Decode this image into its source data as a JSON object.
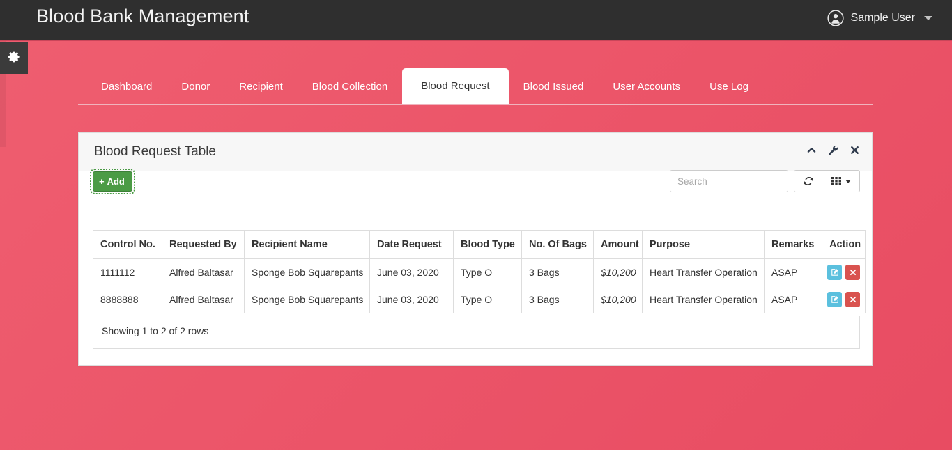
{
  "header": {
    "brand": "Blood Bank Management",
    "user_name": "Sample User",
    "user_icon": "user-circle-icon",
    "caret_icon": "chevron-down-icon",
    "gear_icon": "gear-icon"
  },
  "tabs": [
    {
      "label": "Dashboard",
      "active": false
    },
    {
      "label": "Donor",
      "active": false
    },
    {
      "label": "Recipient",
      "active": false
    },
    {
      "label": "Blood Collection",
      "active": false
    },
    {
      "label": "Blood Request",
      "active": true
    },
    {
      "label": "Blood Issued",
      "active": false
    },
    {
      "label": "User Accounts",
      "active": false
    },
    {
      "label": "Use Log",
      "active": false
    }
  ],
  "panel": {
    "title": "Blood Request Table",
    "tools": [
      {
        "name": "collapse-icon",
        "glyph": "chevron-up"
      },
      {
        "name": "wrench-icon",
        "glyph": "wrench"
      },
      {
        "name": "close-icon",
        "glyph": "times"
      }
    ]
  },
  "toolbar": {
    "add_label": "Add",
    "add_plus": "+",
    "search_placeholder": "Search",
    "search_value": "",
    "refresh_icon": "refresh-icon",
    "columns_icon": "columns-grid-icon"
  },
  "table": {
    "columns": [
      "Control No.",
      "Requested By",
      "Recipient Name",
      "Date Request",
      "Blood Type",
      "No. Of Bags",
      "Amount",
      "Purpose",
      "Remarks",
      "Action"
    ],
    "rows": [
      {
        "control_no": "1111112",
        "requested_by": "Alfred Baltasar",
        "recipient_name": "Sponge Bob Squarepants",
        "date_request": "June 03, 2020",
        "blood_type": "Type O",
        "no_of_bags": "3 Bags",
        "amount": "$10,200",
        "purpose": "Heart Transfer Operation",
        "remarks": "ASAP"
      },
      {
        "control_no": "8888888",
        "requested_by": "Alfred Baltasar",
        "recipient_name": "Sponge Bob Squarepants",
        "date_request": "June 03, 2020",
        "blood_type": "Type O",
        "no_of_bags": "3 Bags",
        "amount": "$10,200",
        "purpose": "Heart Transfer Operation",
        "remarks": "ASAP"
      }
    ],
    "row_actions": {
      "edit_icon": "edit-pencil-icon",
      "delete_icon": "delete-times-icon"
    },
    "footer_text": "Showing 1 to 2 of 2 rows"
  },
  "colors": {
    "page_background": "#ea5367",
    "navbar": "#2f2f2f",
    "add_button": "#4b9b45",
    "edit_button": "#5bc0de",
    "delete_button": "#d9534f",
    "amount_text": "#0000ff"
  }
}
